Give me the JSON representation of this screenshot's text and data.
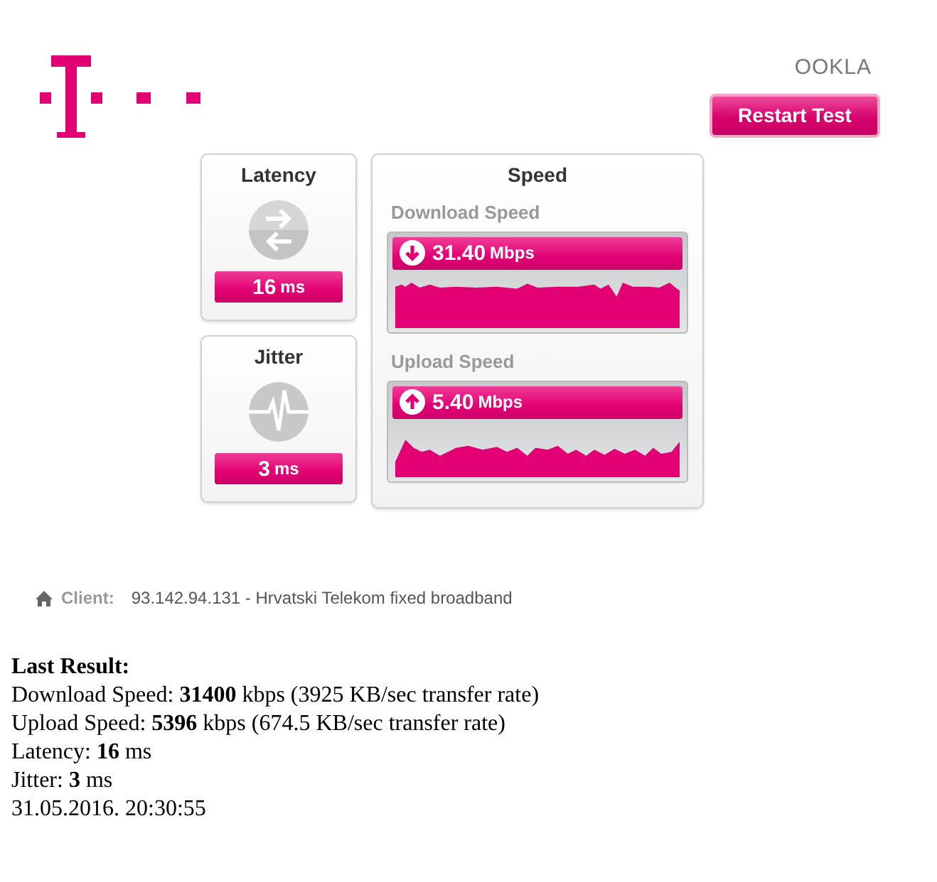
{
  "header": {
    "brand": "OOKLA",
    "button": "Restart Test"
  },
  "metrics": [
    {
      "title": "Latency",
      "kind": "latency",
      "value": "16",
      "unit": "ms"
    },
    {
      "title": "Jitter",
      "kind": "jitter",
      "value": "3",
      "unit": "ms"
    }
  ],
  "speed": {
    "title": "Speed",
    "tests": [
      {
        "label": "Download Speed",
        "kind": "download",
        "value": "31.40",
        "unit": "Mbps"
      },
      {
        "label": "Upload Speed",
        "kind": "upload",
        "value": "5.40",
        "unit": "Mbps"
      }
    ]
  },
  "client": {
    "label": "Client:",
    "value": "93.142.94.131 - Hrvatski Telekom fixed broadband"
  },
  "last_result": {
    "title": "Last Result:",
    "lines": [
      "Download Speed: **31400** kbps (3925 KB/sec transfer rate)",
      "Upload Speed: **5396** kbps (674.5 KB/sec transfer rate)",
      "Latency: **16** ms",
      "Jitter: **3** ms",
      "31.05.2016. 20:30:55"
    ]
  }
}
